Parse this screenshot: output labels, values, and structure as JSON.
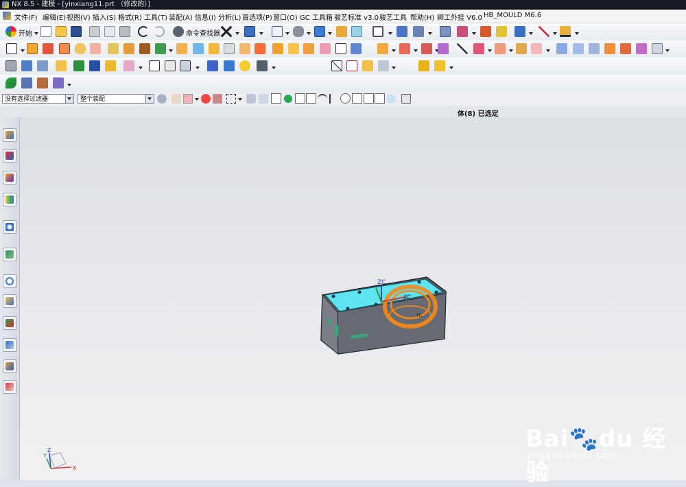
{
  "window": {
    "title": "NX 8.5 - 建模 - [yinxiang11.prt （修改的）]"
  },
  "menu": {
    "items": [
      "文件(F)",
      "编辑(E)",
      "视图(V)",
      "插入(S)",
      "格式(R)",
      "工具(T)",
      "装配(A)",
      "信息(I)",
      "分析(L)",
      "首选项(P)",
      "窗口(O)",
      "GC 工具箱",
      "骏艺标准 v3.0",
      "骏艺工具",
      "帮助(H)",
      "卿工外挂 V6.0",
      "HB_MOULD M6.6"
    ]
  },
  "toolbar": {
    "start_label": "开始",
    "command_finder_label": "命令查找器"
  },
  "selection_bar": {
    "filter_value": "没有选择过滤器",
    "scope_value": "整个装配"
  },
  "status": {
    "text": "体(8) 已选定"
  },
  "model": {
    "labels": {
      "zc": "ZC",
      "xc": "XC",
      "yc": "YC"
    },
    "body_color": "#5ee3f0",
    "selection_color": "#f28a1a"
  },
  "triad": {
    "x": "X",
    "y": "Y",
    "z": "Z"
  },
  "watermark": {
    "logo": "Bai🐾du 经验",
    "sub": "jingyan.baidu.com"
  },
  "colors": {
    "title_bg": "#151a22",
    "viewport_top": "#dcdfe3",
    "viewport_bottom": "#f1f1f3"
  }
}
